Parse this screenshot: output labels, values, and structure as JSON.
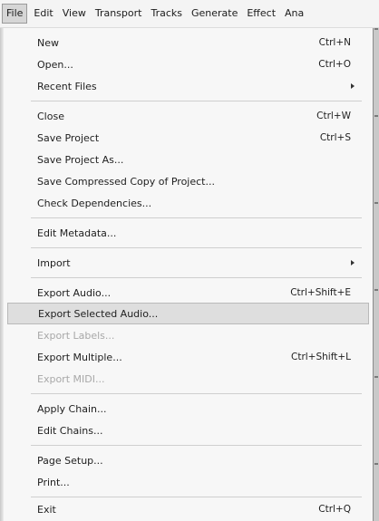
{
  "menubar": {
    "items": [
      {
        "label": "File",
        "active": true
      },
      {
        "label": "Edit"
      },
      {
        "label": "View"
      },
      {
        "label": "Transport"
      },
      {
        "label": "Tracks"
      },
      {
        "label": "Generate"
      },
      {
        "label": "Effect"
      },
      {
        "label": "Ana"
      }
    ]
  },
  "file_menu": {
    "items": [
      {
        "label": "New",
        "shortcut": "Ctrl+N"
      },
      {
        "label": "Open...",
        "shortcut": "Ctrl+O"
      },
      {
        "label": "Recent Files",
        "submenu": true
      },
      {
        "label": "Close",
        "shortcut": "Ctrl+W"
      },
      {
        "label": "Save Project",
        "shortcut": "Ctrl+S"
      },
      {
        "label": "Save Project As..."
      },
      {
        "label": "Save Compressed Copy of Project..."
      },
      {
        "label": "Check Dependencies..."
      },
      {
        "label": "Edit Metadata..."
      },
      {
        "label": "Import",
        "submenu": true
      },
      {
        "label": "Export Audio...",
        "shortcut": "Ctrl+Shift+E"
      },
      {
        "label": "Export Selected Audio...",
        "highlighted": true
      },
      {
        "label": "Export Labels...",
        "disabled": true
      },
      {
        "label": "Export Multiple...",
        "shortcut": "Ctrl+Shift+L"
      },
      {
        "label": "Export MIDI...",
        "disabled": true
      },
      {
        "label": "Apply Chain..."
      },
      {
        "label": "Edit Chains..."
      },
      {
        "label": "Page Setup..."
      },
      {
        "label": "Print..."
      },
      {
        "label": "Exit",
        "shortcut": "Ctrl+Q"
      }
    ]
  },
  "icons": {
    "submenu_arrow": "chevron-right-icon"
  }
}
